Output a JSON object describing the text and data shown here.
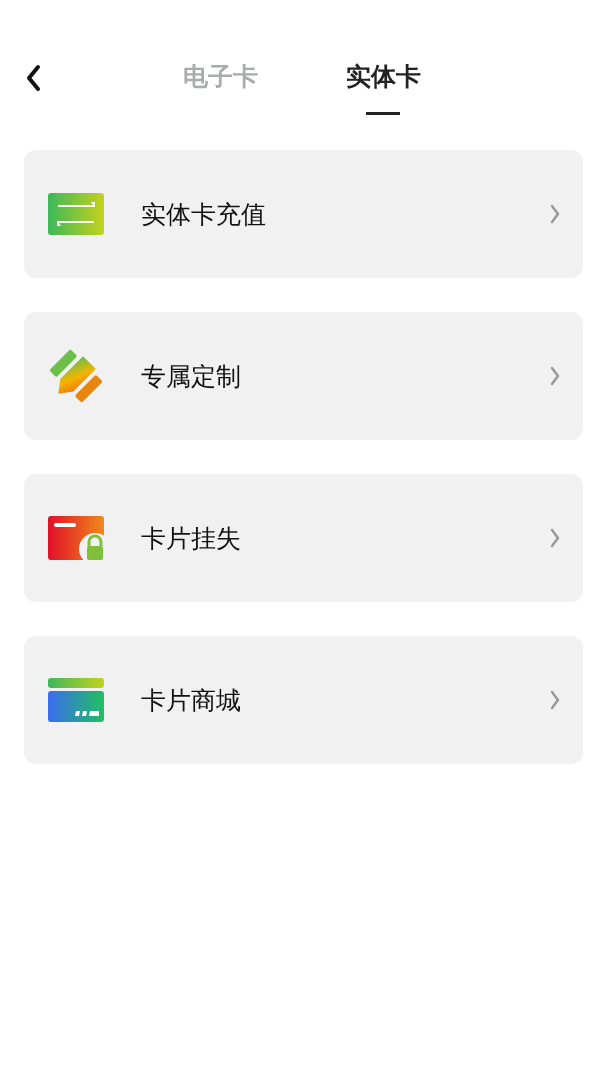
{
  "tabs": [
    {
      "label": "电子卡",
      "selected": false
    },
    {
      "label": "实体卡",
      "selected": true
    }
  ],
  "menu": [
    {
      "kind": "recharge",
      "label": "实体卡充值"
    },
    {
      "kind": "custom",
      "label": "专属定制"
    },
    {
      "kind": "lost",
      "label": "卡片挂失"
    },
    {
      "kind": "shop",
      "label": "卡片商城"
    }
  ]
}
